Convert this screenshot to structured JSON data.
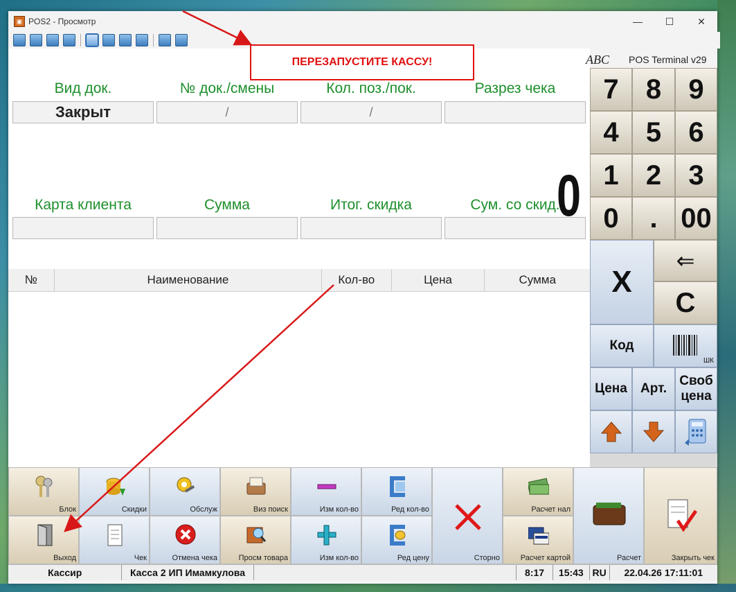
{
  "window": {
    "title": "POS2 - Просмотр",
    "brand": "ABC",
    "version": "POS Terminal v29",
    "controls": {
      "minimize": "—",
      "maximize": "☐",
      "close": "✕"
    }
  },
  "callout": {
    "text": "ПЕРЕЗАПУСТИТЕ КАССУ!"
  },
  "doc": {
    "labels": {
      "doc_type": "Вид док.",
      "doc_shift": "№ док./смены",
      "qty_pos": "Кол. поз./пок.",
      "receipt_split": "Разрез чека"
    },
    "values": {
      "doc_type": "Закрыт",
      "doc_shift": "/",
      "qty_pos": "/",
      "receipt_split": ""
    }
  },
  "display": {
    "amount": "0"
  },
  "summary": {
    "labels": {
      "client_card": "Карта клиента",
      "sum": "Сумма",
      "total_discount": "Итог. скидка",
      "sum_discount": "Сум. со скид."
    },
    "values": {
      "client_card": "",
      "sum": "",
      "total_discount": "",
      "sum_discount": ""
    }
  },
  "table": {
    "headers": [
      "№",
      "Наименование",
      "Кол-во",
      "Цена",
      "Сумма"
    ]
  },
  "keypad": {
    "digits": [
      "7",
      "8",
      "9",
      "4",
      "5",
      "6",
      "1",
      "2",
      "3",
      "0",
      ".",
      "00"
    ],
    "x": "X",
    "backspace": "⇐",
    "clear": "C",
    "code": "Код",
    "barcode": "ШК",
    "price": "Цена",
    "art": "Арт.",
    "free_price_1": "Своб",
    "free_price_2": "цена"
  },
  "buttons": {
    "block": "Блок",
    "discounts": "Скидки",
    "service": "Обслуж",
    "visual_search": "Виз поиск",
    "change_qty_minus": "Изм кол-во",
    "edit_qty": "Ред кол-во",
    "storno": "Сторно",
    "cash_payment": "Расчет нал",
    "payment": "Расчет",
    "close_receipt": "Закрыть чек",
    "exit": "Выход",
    "receipt": "Чек",
    "cancel_receipt": "Отмена чека",
    "view_goods": "Просм товара",
    "change_qty_plus": "Изм кол-во",
    "edit_price": "Ред цену",
    "card_payment": "Расчет картой"
  },
  "status": {
    "role": "Кассир",
    "register": "Касса 2 ИП Имамкулова",
    "time1": "8:17",
    "time2": "15:43",
    "lang": "RU",
    "datetime": "22.04.26  17:11:01"
  },
  "colors": {
    "label_green": "#1d8f2c",
    "callout_red": "#e01010"
  }
}
